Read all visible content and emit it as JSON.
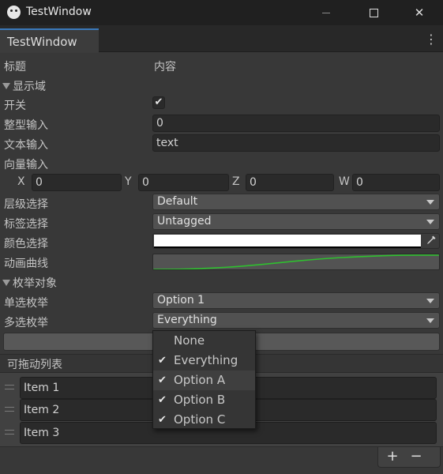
{
  "window": {
    "title": "TestWindow",
    "controls": {
      "close": "✕"
    }
  },
  "tab": {
    "label": "TestWindow",
    "menu_icon": "⋮"
  },
  "header": {
    "name_col": "标题",
    "value_col": "内容"
  },
  "display_section": {
    "label": "显示域"
  },
  "fields": {
    "toggle": {
      "label": "开关",
      "checked": true,
      "check": "✔"
    },
    "int_input": {
      "label": "整型输入",
      "value": "0"
    },
    "text_input": {
      "label": "文本输入",
      "value": "text"
    },
    "vector_input": {
      "label": "向量输入",
      "components": [
        {
          "axis": "X",
          "value": "0"
        },
        {
          "axis": "Y",
          "value": "0"
        },
        {
          "axis": "Z",
          "value": "0"
        },
        {
          "axis": "W",
          "value": "0"
        }
      ]
    },
    "layer": {
      "label": "层级选择",
      "value": "Default"
    },
    "tag": {
      "label": "标签选择",
      "value": "Untagged"
    },
    "color": {
      "label": "颜色选择",
      "value": "#FFFFFF",
      "eyedropper_icon": "eyedropper-icon"
    },
    "curve": {
      "label": "动画曲线",
      "curve_color": "#2fbf2f"
    }
  },
  "enum_section": {
    "label": "枚举对象"
  },
  "enums": {
    "single": {
      "label": "单选枚举",
      "value": "Option 1"
    },
    "flags": {
      "label": "多选枚举",
      "value": "Everything"
    }
  },
  "flags_popup": {
    "items": [
      {
        "label": "None",
        "checked": false,
        "check": ""
      },
      {
        "label": "Everything",
        "checked": true,
        "check": "✔"
      },
      {
        "label": "Option A",
        "checked": true,
        "check": "✔"
      },
      {
        "label": "Option B",
        "checked": true,
        "check": "✔"
      },
      {
        "label": "Option C",
        "checked": true,
        "check": "✔"
      }
    ]
  },
  "reorderable_list": {
    "header": "可拖动列表",
    "items": [
      "Item 1",
      "Item 2",
      "Item 3"
    ],
    "add": "+",
    "remove": "−"
  }
}
